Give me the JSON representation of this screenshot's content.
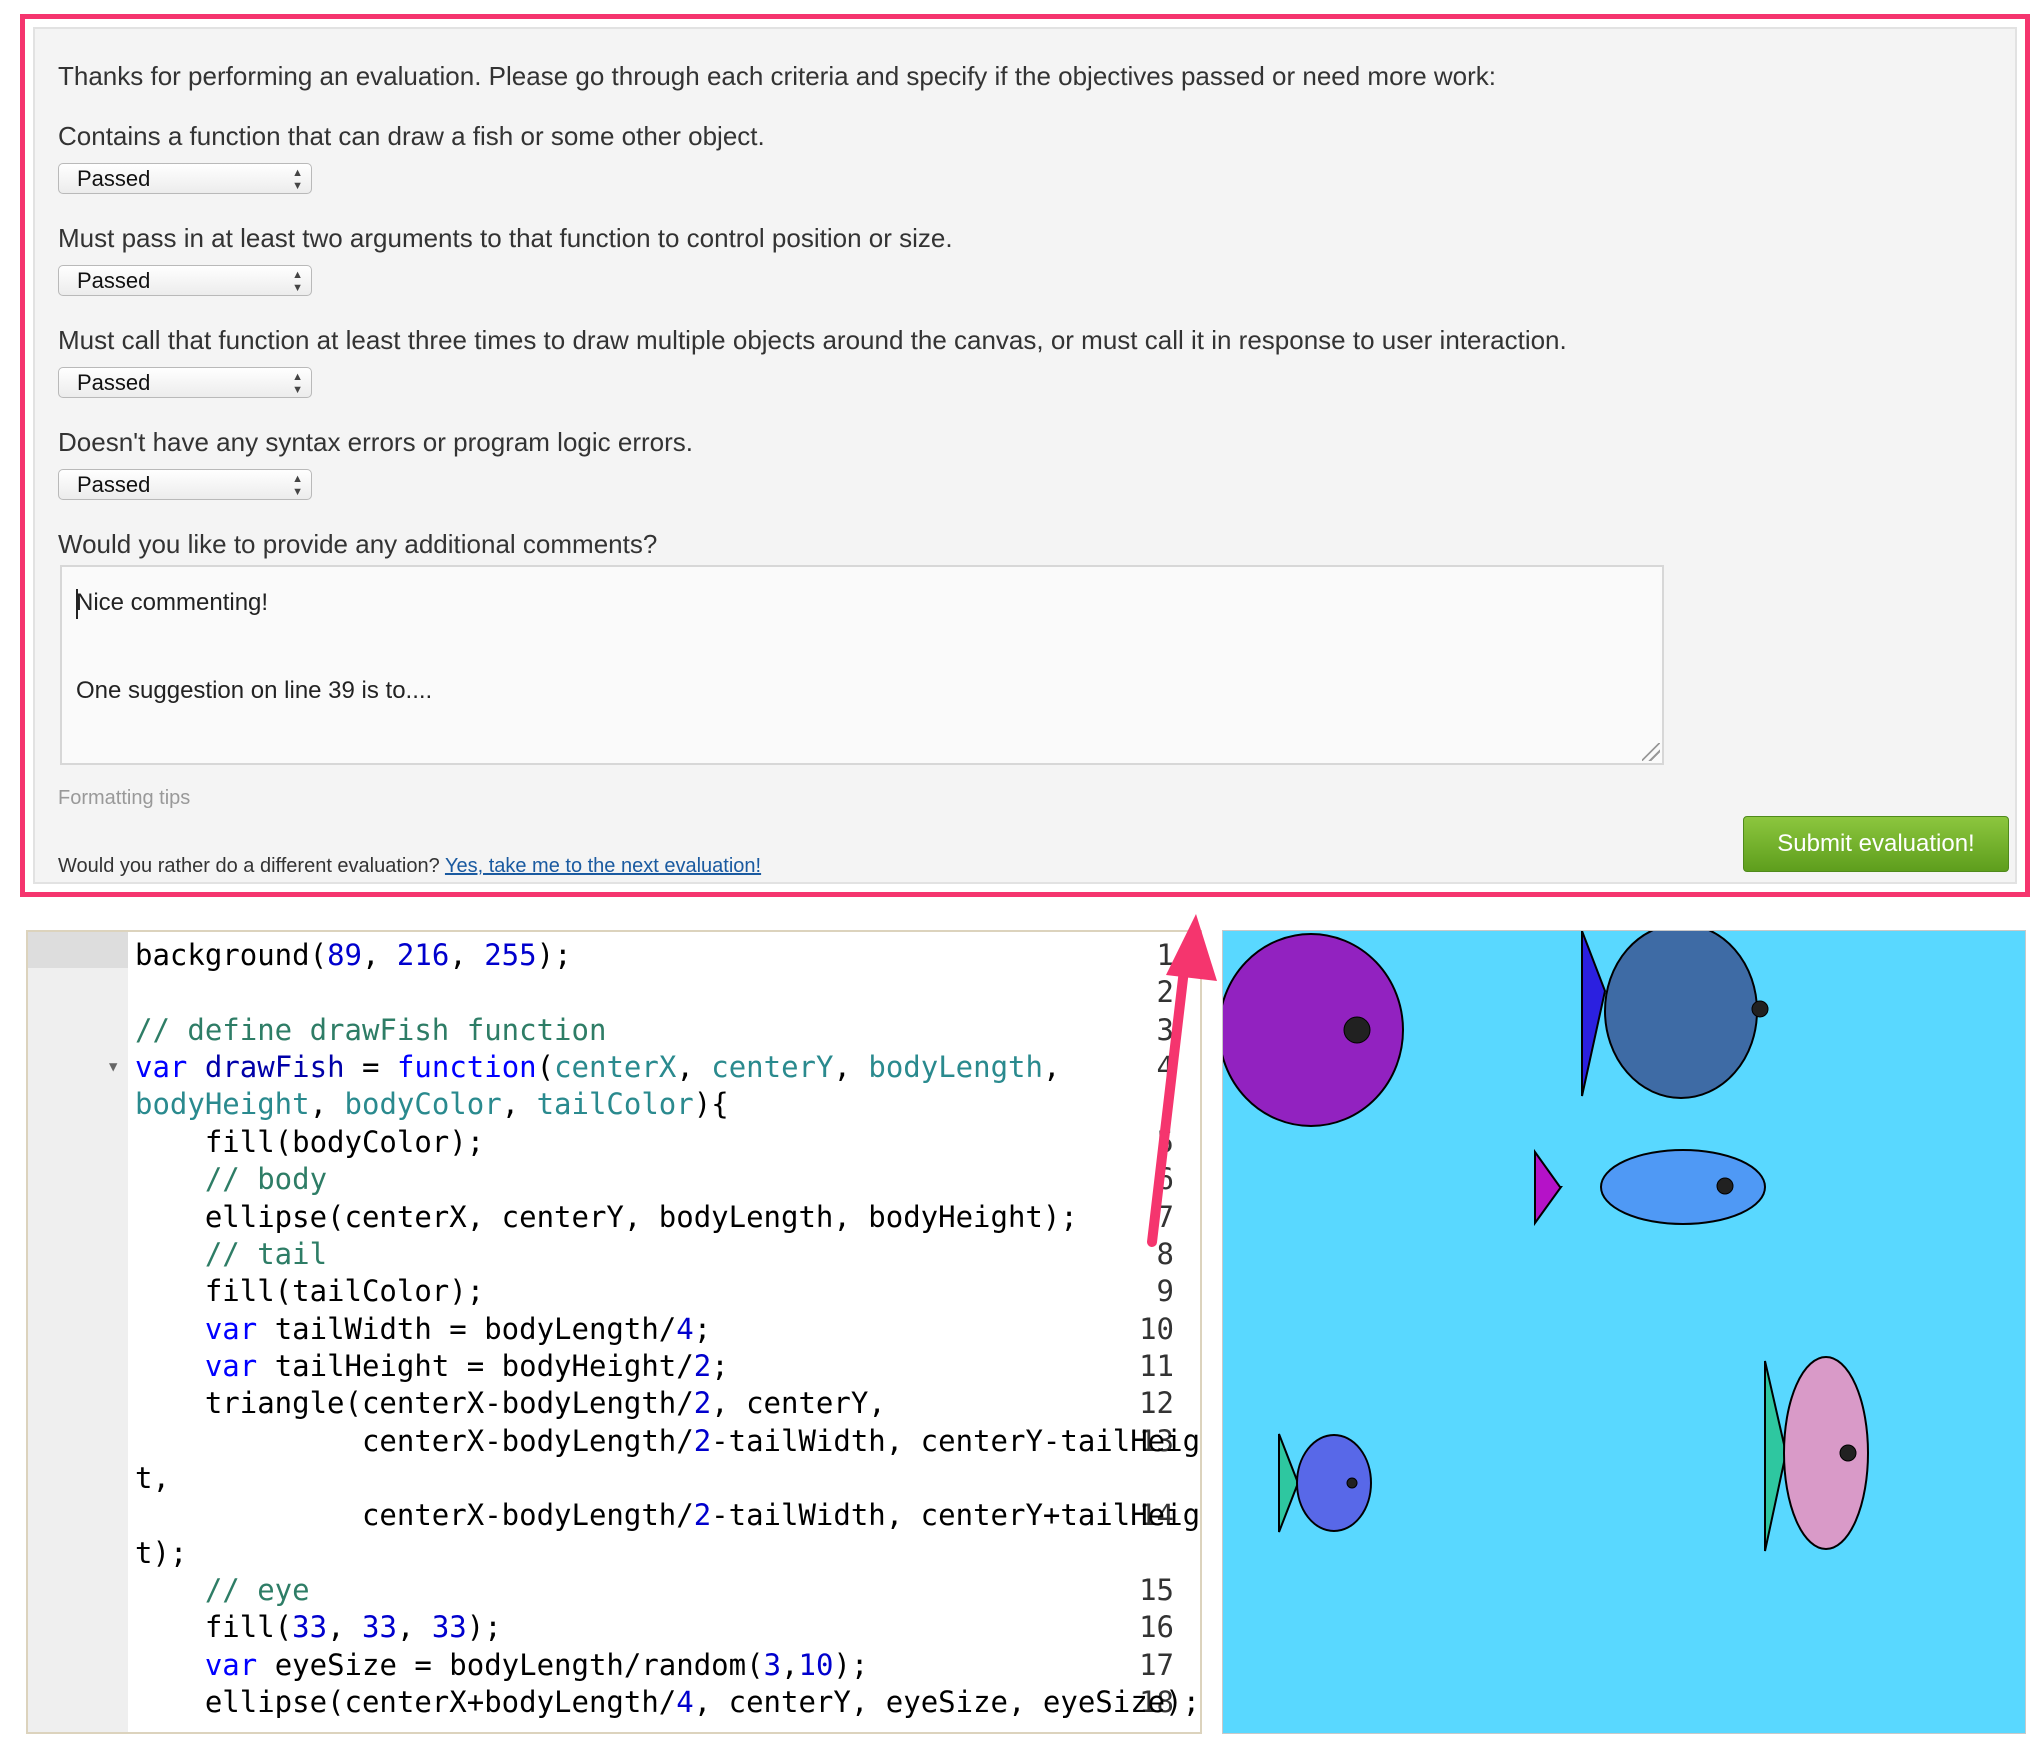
{
  "evaluation": {
    "intro": "Thanks for performing an evaluation. Please go through each criteria and specify if the objectives passed or need more work:",
    "criteria": [
      {
        "question": "Contains a function that can draw a fish or some other object.",
        "value": "Passed"
      },
      {
        "question": "Must pass in at least two arguments to that function to control position or size.",
        "value": "Passed"
      },
      {
        "question": "Must call that function at least three times to draw multiple objects around the canvas, or must call it in response to user interaction.",
        "value": "Passed"
      },
      {
        "question": "Doesn't have any syntax errors or program logic errors.",
        "value": "Passed"
      }
    ],
    "comments_prompt": "Would you like to provide any additional comments?",
    "comment_line1": "Nice commenting!",
    "comment_line2": "One suggestion on line 39 is to....",
    "formatting_tips": "Formatting tips",
    "different_prompt": "Would you rather do a different evaluation?",
    "next_link": "Yes, take me to the next evaluation!",
    "submit_label": "Submit evaluation!"
  },
  "editor": {
    "line_numbers": [
      "1",
      "2",
      "3",
      "4",
      "5",
      "6",
      "7",
      "8",
      "9",
      "10",
      "11",
      "12",
      "13",
      "14",
      "15",
      "16",
      "17",
      "18"
    ],
    "code": [
      "background(89, 216, 255);",
      "",
      "// define drawFish function",
      "var drawFish = function(centerX, centerY, bodyLength,",
      "bodyHeight, bodyColor, tailColor){",
      "    fill(bodyColor);",
      "    // body",
      "    ellipse(centerX, centerY, bodyLength, bodyHeight);",
      "    // tail",
      "    fill(tailColor);",
      "    var tailWidth = bodyLength/4;",
      "    var tailHeight = bodyHeight/2;",
      "    triangle(centerX-bodyLength/2, centerY,",
      "             centerX-bodyLength/2-tailWidth, centerY-tailHeigh",
      "t,",
      "             centerX-bodyLength/2-tailWidth, centerY+tailHeigh",
      "t);",
      "    // eye",
      "    fill(33, 33, 33);",
      "    var eyeSize = bodyLength/random(3,10);",
      "    ellipse(centerX+bodyLength/4, centerY, eyeSize, eyeSize);"
    ]
  },
  "canvas": {
    "background": "#59d8ff",
    "fish": [
      {
        "body_color": "#9222c0",
        "tail_color": "#9222c0"
      },
      {
        "body_color": "#3e6ba5",
        "tail_color": "#2b20e0"
      },
      {
        "body_color": "#4f99f5",
        "tail_color": "#b512c8"
      },
      {
        "body_color": "#5868e8",
        "tail_color": "#2ec7a0"
      },
      {
        "body_color": "#d99ac8",
        "tail_color": "#2ec7a0"
      }
    ]
  },
  "colors": {
    "highlight_border": "#f5356e",
    "submit_green": "#6aad25",
    "link_blue": "#1a5aa0"
  }
}
